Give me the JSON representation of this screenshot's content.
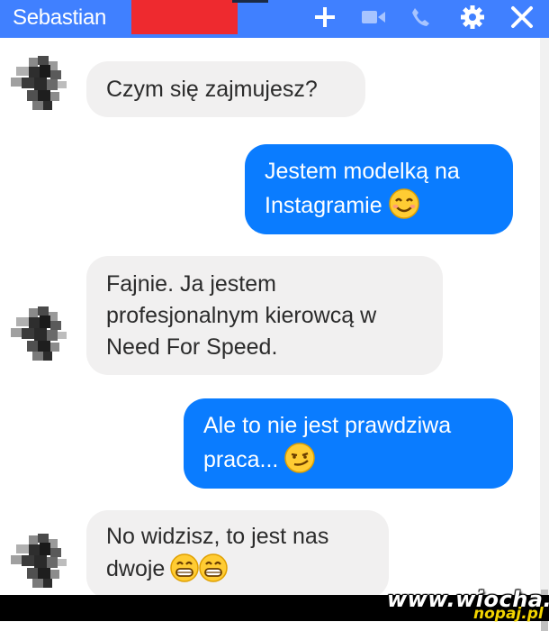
{
  "header": {
    "title": "Sebastian",
    "icons": [
      "plus-icon",
      "video-icon",
      "phone-icon",
      "gear-icon",
      "close-icon"
    ],
    "colors": {
      "bar": "#4080ff",
      "redaction": "#ee2a2f"
    }
  },
  "messages": [
    {
      "sender": "contact",
      "lines": [
        "Czym się zajmujesz?"
      ]
    },
    {
      "sender": "me",
      "lines": [
        "Jestem modelką na",
        "Instagramie"
      ],
      "emoji": "smiling-blush-emoji"
    },
    {
      "sender": "contact",
      "lines": [
        "Fajnie. Ja jestem",
        "profesjonalnym kierowcą w",
        "Need For Speed."
      ]
    },
    {
      "sender": "me",
      "lines": [
        "Ale to nie jest prawdziwa",
        "praca..."
      ],
      "emoji": "smirk-emoji"
    },
    {
      "sender": "contact",
      "lines": [
        "No widzisz, to jest nas",
        "dwoje"
      ],
      "emoji": "grin-emoji-x2"
    }
  ],
  "colors": {
    "incoming_bubble": "#f1f0f0",
    "outgoing_bubble": "#0a7cff"
  },
  "watermark": {
    "text": "www.wiocha.pl",
    "sub": "nopaj.pl"
  }
}
